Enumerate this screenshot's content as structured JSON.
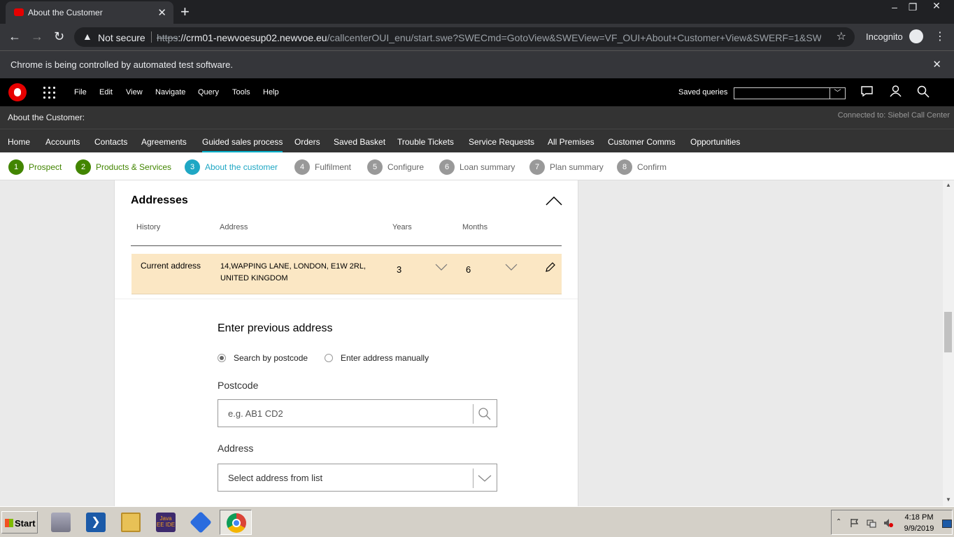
{
  "browser": {
    "tab_title": "About the Customer",
    "security_label": "Not secure",
    "url_scheme": "https",
    "url_host": "://crm01-newvoesup02.newvoe.eu",
    "url_rest": "/callcenterOUI_enu/start.swe?SWECmd=GotoView&SWEView=VF_OUI+About+Customer+View&SWERF=1&SW...",
    "incognito_label": "Incognito",
    "infobar_message": "Chrome is being controlled by automated test software."
  },
  "app": {
    "menu": [
      "File",
      "Edit",
      "View",
      "Navigate",
      "Query",
      "Tools",
      "Help"
    ],
    "saved_queries_label": "Saved queries",
    "saved_queries_value": "",
    "view_title": "About the Customer:",
    "connected_to": "Connected to: Siebel Call Center",
    "screen_tabs": [
      "Home",
      "Accounts",
      "Contacts",
      "Agreements",
      "Guided sales process",
      "Orders",
      "Saved Basket",
      "Trouble Tickets",
      "Service Requests",
      "All Premises",
      "Customer Comms",
      "Opportunities"
    ],
    "active_tab": "Guided sales process"
  },
  "steps": [
    {
      "num": "1",
      "label": "Prospect",
      "state": "done"
    },
    {
      "num": "2",
      "label": "Products & Services",
      "state": "done"
    },
    {
      "num": "3",
      "label": "About the customer",
      "state": "current"
    },
    {
      "num": "4",
      "label": "Fulfilment",
      "state": "todo"
    },
    {
      "num": "5",
      "label": "Configure",
      "state": "todo"
    },
    {
      "num": "6",
      "label": "Loan summary",
      "state": "todo"
    },
    {
      "num": "7",
      "label": "Plan summary",
      "state": "todo"
    },
    {
      "num": "8",
      "label": "Confirm",
      "state": "todo"
    }
  ],
  "addresses": {
    "heading": "Addresses",
    "columns": {
      "history": "History",
      "address": "Address",
      "years": "Years",
      "months": "Months"
    },
    "rows": [
      {
        "history": "Current address",
        "address": "14,WAPPING LANE, LONDON, E1W 2RL, UNITED KINGDOM",
        "years": "3",
        "months": "6"
      }
    ]
  },
  "previous_address": {
    "title": "Enter previous address",
    "radio_postcode": "Search by postcode",
    "radio_manual": "Enter address manually",
    "selected_mode": "postcode",
    "postcode_label": "Postcode",
    "postcode_placeholder": "e.g. AB1 CD2",
    "address_label": "Address",
    "address_select_value": "Select address from list"
  },
  "taskbar": {
    "start_label": "Start",
    "time": "4:18 PM",
    "date": "9/9/2019",
    "java_icon_text": "Java EE IDE"
  },
  "colors": {
    "brand_red": "#e60000",
    "step_done": "#428500",
    "step_current": "#1fa7c4",
    "row_highlight": "#fbe7c4"
  }
}
